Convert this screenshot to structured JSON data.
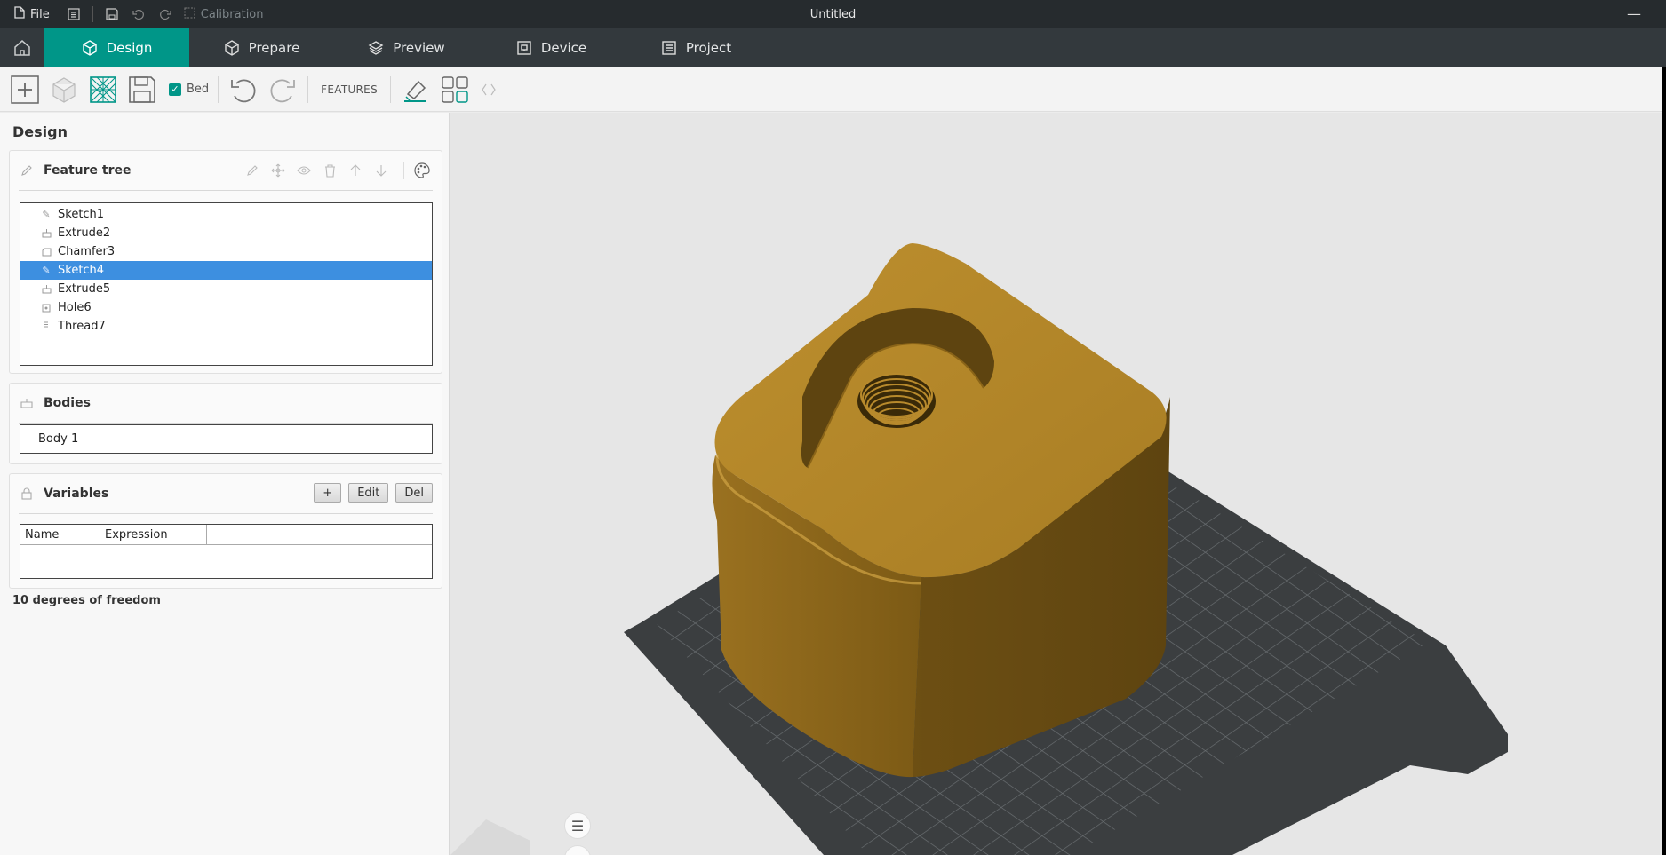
{
  "titlebar": {
    "file_label": "File",
    "calibration_label": "Calibration",
    "window_title": "Untitled"
  },
  "tabs": [
    {
      "label": "Design",
      "active": true
    },
    {
      "label": "Prepare",
      "active": false
    },
    {
      "label": "Preview",
      "active": false
    },
    {
      "label": "Device",
      "active": false
    },
    {
      "label": "Project",
      "active": false
    }
  ],
  "toolbar": {
    "bed_label": "Bed",
    "bed_checked": true,
    "features_label": "FEATURES"
  },
  "design_panel": {
    "title": "Design",
    "feature_tree": {
      "title": "Feature tree",
      "items": [
        {
          "label": "Sketch1",
          "icon": "pencil-icon",
          "selected": false
        },
        {
          "label": "Extrude2",
          "icon": "extrude-icon",
          "selected": false
        },
        {
          "label": "Chamfer3",
          "icon": "chamfer-icon",
          "selected": false
        },
        {
          "label": "Sketch4",
          "icon": "pencil-icon",
          "selected": true
        },
        {
          "label": "Extrude5",
          "icon": "extrude-icon",
          "selected": false
        },
        {
          "label": "Hole6",
          "icon": "hole-icon",
          "selected": false
        },
        {
          "label": "Thread7",
          "icon": "thread-icon",
          "selected": false
        }
      ]
    },
    "bodies": {
      "title": "Bodies",
      "items": [
        "Body 1"
      ]
    },
    "variables": {
      "title": "Variables",
      "add_label": "+",
      "edit_label": "Edit",
      "delete_label": "Del",
      "columns": [
        "Name",
        "Expression"
      ]
    },
    "dof_status": "10 degrees of freedom"
  },
  "colors": {
    "accent": "#009688",
    "selection": "#3d8fe0",
    "model_top": "#b8892a",
    "model_side": "#8a6418",
    "bed": "#3c3f41"
  }
}
